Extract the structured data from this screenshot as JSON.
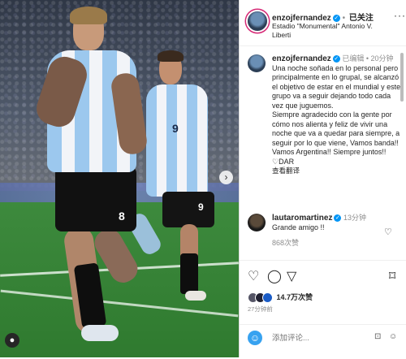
{
  "post": {
    "username": "enzojfernandez",
    "follow_status": "已关注",
    "location": "Estadio \"Monumental\" Antonio V. Liberti",
    "more_label": "···"
  },
  "caption": {
    "username": "enzojfernandez",
    "edited": "已编辑",
    "time": "20分钟",
    "text": "Una noche soñada en lo personal pero principalmente en lo grupal, se alcanzó el objetivo de estar en el mundial y este grupo va a seguir dejando todo cada vez que juguemos.",
    "text2": "Siempre agradecido con la gente por cómo nos alienta y feliz de vivir una noche que va a quedar para siempre, a seguir por lo que viene, Vamos banda!! Vamos Argentina!! Siempre juntos!! ♡DAR",
    "see_translation": "查看翻译"
  },
  "comment": {
    "username": "lautaromartinez",
    "time": "13分钟",
    "text": "Grande amigo !!",
    "likes": "868次赞"
  },
  "actions": {
    "like_icon": "♡",
    "comment_icon": "◯",
    "share_icon": "▽",
    "save_icon": "⌑"
  },
  "likes_count": "14.7万次赞",
  "date": "27分钟前",
  "add_comment_placeholder": "添加评论...",
  "photo": {
    "player1_number": "8",
    "player2_number": "9",
    "player2_shorts_number": "9"
  },
  "colors": {
    "verified": "#0095f6",
    "meta_gray": "#8e8e8e",
    "text": "#262626"
  }
}
